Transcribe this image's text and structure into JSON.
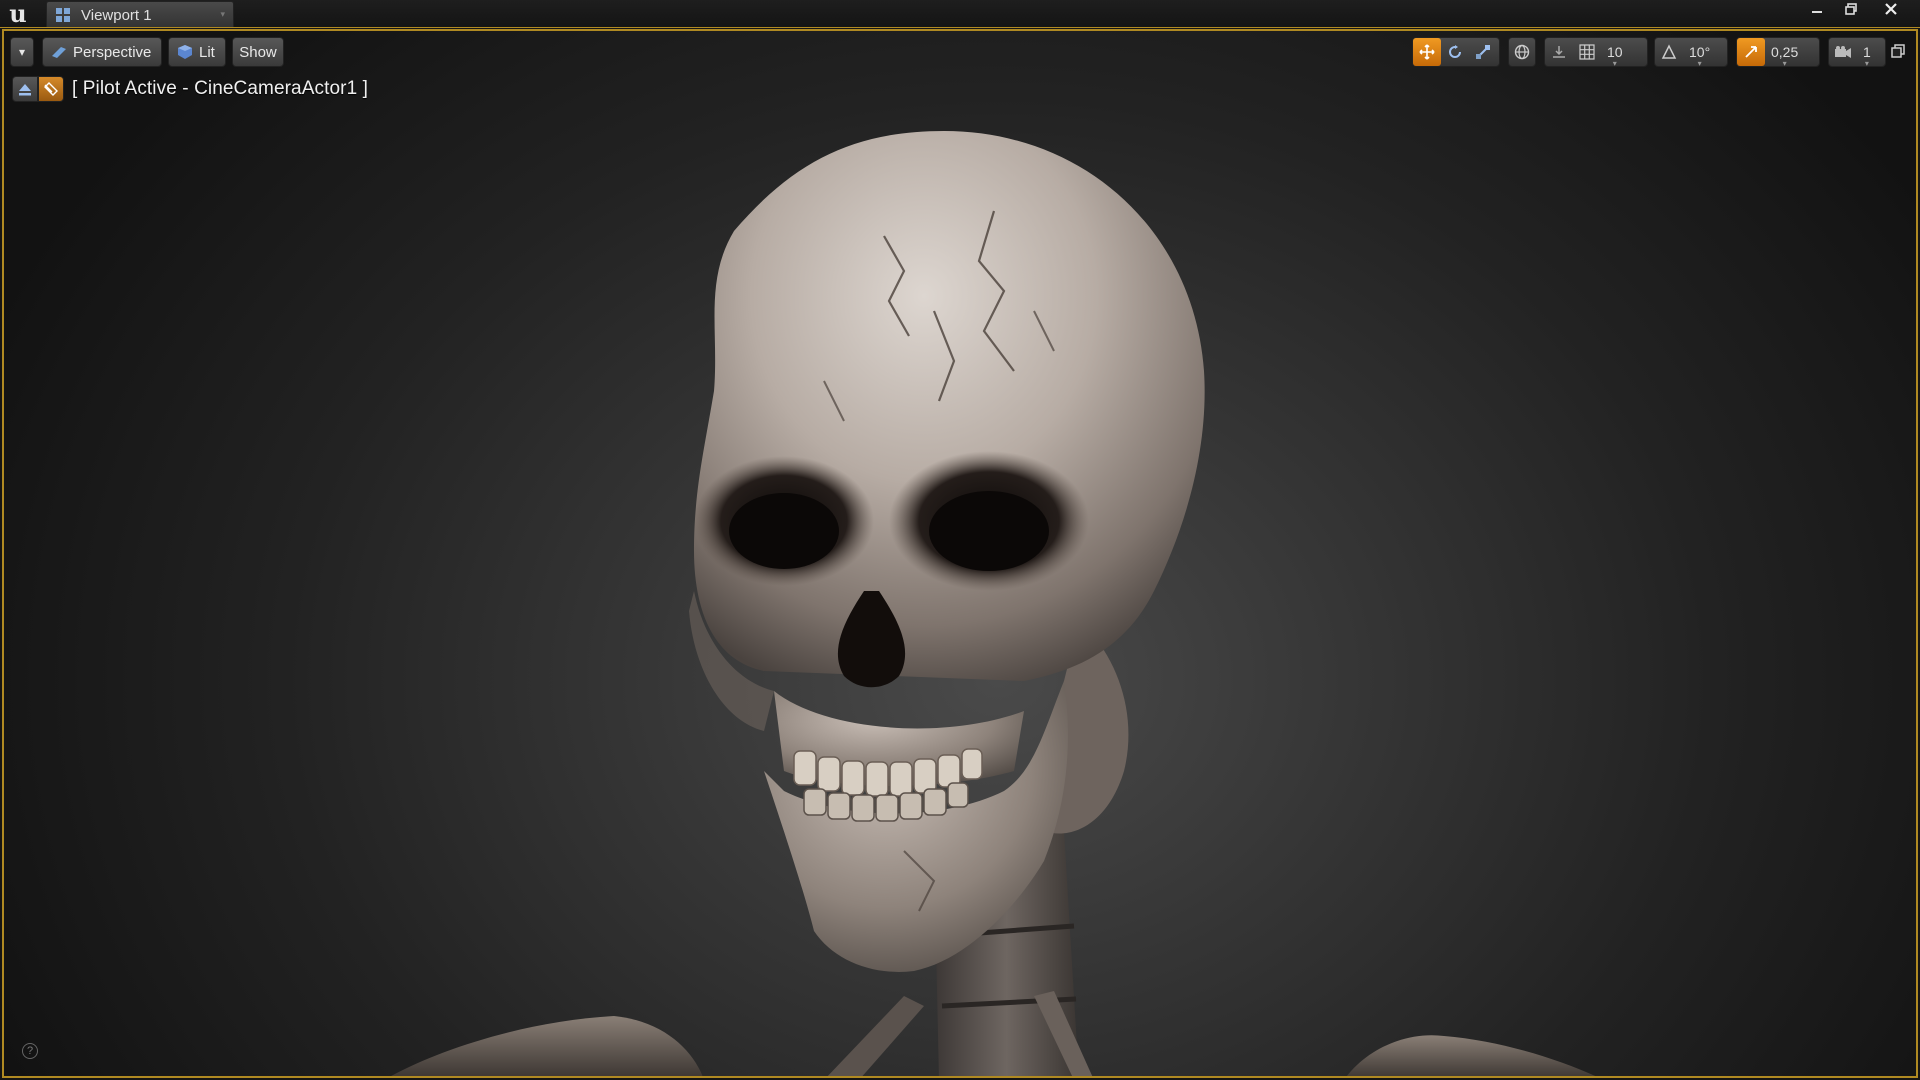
{
  "window": {
    "logo_text": "u",
    "tab_label": "Viewport 1",
    "tab_caret": "▾",
    "accent_color": "#b08a22"
  },
  "viewport_toolbar": {
    "options_caret": "▾",
    "view_mode": "Perspective",
    "lighting_mode": "Lit",
    "show_label": "Show",
    "grid_snap_value": "10",
    "rotation_snap_value": "10°",
    "scale_snap_value": "0,25",
    "camera_speed_value": "1",
    "active_tool_color": "#e8871a"
  },
  "pilot": {
    "label": "[ Pilot Active - CineCameraActor1 ]"
  },
  "scene": {
    "subject": "skeleton-head-model",
    "background": "dark-gradient"
  },
  "help": {
    "glyph": "?"
  }
}
